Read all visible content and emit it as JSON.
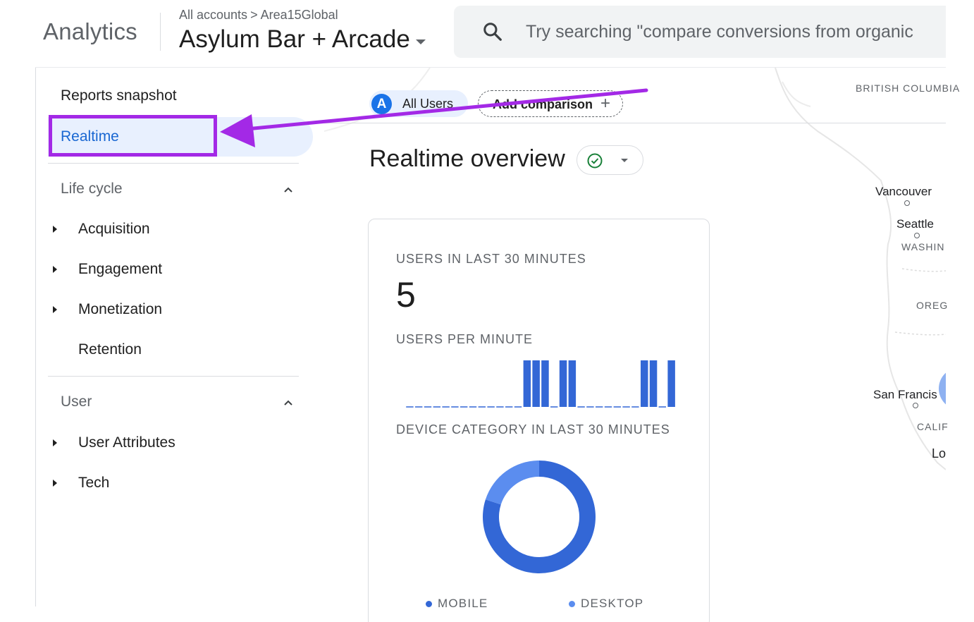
{
  "header": {
    "brand": "Analytics",
    "breadcrumb": {
      "all_accounts": "All accounts",
      "separator": ">",
      "account": "Area15Global"
    },
    "property": "Asylum Bar + Arcade",
    "search_text": "Try searching \"compare conversions from organic"
  },
  "sidebar": {
    "reports_snapshot": "Reports snapshot",
    "realtime": "Realtime",
    "sections": [
      {
        "title": "Life cycle",
        "items": [
          "Acquisition",
          "Engagement",
          "Monetization",
          "Retention"
        ]
      },
      {
        "title": "User",
        "items": [
          "User Attributes",
          "Tech"
        ]
      }
    ]
  },
  "comparison": {
    "avatar_letter": "A",
    "all_users": "All Users",
    "add_comparison": "Add comparison"
  },
  "main": {
    "title": "Realtime overview",
    "card": {
      "users_label": "USERS IN LAST 30 MINUTES",
      "users_value": "5",
      "per_minute_label": "USERS PER MINUTE",
      "device_label": "DEVICE CATEGORY IN LAST 30 MINUTES"
    }
  },
  "chart_data": [
    {
      "type": "bar",
      "title": "USERS PER MINUTE",
      "x": [
        1,
        2,
        3,
        4,
        5,
        6,
        7,
        8,
        9,
        10,
        11,
        12,
        13,
        14,
        15,
        16,
        17,
        18,
        19,
        20,
        21,
        22,
        23,
        24,
        25,
        26,
        27,
        28,
        29,
        30
      ],
      "values": [
        0,
        0,
        0,
        0,
        0,
        0,
        0,
        0,
        0,
        0,
        0,
        0,
        0,
        1,
        1,
        1,
        0,
        1,
        1,
        0,
        0,
        0,
        0,
        0,
        0,
        0,
        1,
        1,
        0,
        1
      ],
      "ylim": [
        0,
        1
      ],
      "bar_color": "#3367d6"
    },
    {
      "type": "pie",
      "title": "DEVICE CATEGORY IN LAST 30 MINUTES",
      "categories": [
        "MOBILE",
        "DESKTOP"
      ],
      "values": [
        80,
        20
      ],
      "colors": [
        "#3367d6",
        "#5b8def"
      ],
      "donut": true
    }
  ],
  "map": {
    "regions": [
      "BRITISH COLUMBIA",
      "WASHIN",
      "OREG",
      "CALIF"
    ],
    "cities": [
      "Vancouver",
      "Seattle",
      "San Francis",
      "Lo"
    ]
  },
  "annotation": {
    "color": "#a329e6"
  },
  "colors": {
    "accent": "#1967d2",
    "active_bg": "#e8f0fe",
    "bar": "#3367d6"
  }
}
